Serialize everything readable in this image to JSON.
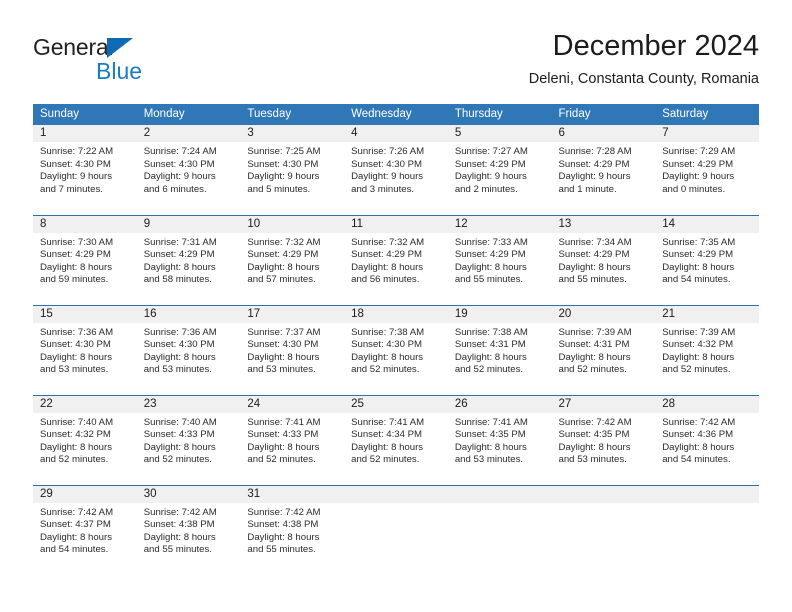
{
  "logo": {
    "word_one": "General",
    "word_two": "Blue",
    "triangle_icon": "blue-triangle-icon",
    "colors": {
      "dark": "#231f20",
      "blue": "#1b7bc4",
      "triangle": "#0d6ab3"
    }
  },
  "header": {
    "title": "December 2024",
    "subtitle": "Deleni, Constanta County, Romania"
  },
  "theme": {
    "header_bg": "#3077b8",
    "header_text": "#ffffff",
    "row_divider": "#2f6fad",
    "daynum_band": "#f0f0f0",
    "body_text": "#2b2b2b",
    "page_bg": "#ffffff"
  },
  "weekday_headers": [
    "Sunday",
    "Monday",
    "Tuesday",
    "Wednesday",
    "Thursday",
    "Friday",
    "Saturday"
  ],
  "weeks": [
    [
      {
        "day": "1",
        "sunrise": "Sunrise: 7:22 AM",
        "sunset": "Sunset: 4:30 PM",
        "daylight_line1": "Daylight: 9 hours",
        "daylight_line2": "and 7 minutes."
      },
      {
        "day": "2",
        "sunrise": "Sunrise: 7:24 AM",
        "sunset": "Sunset: 4:30 PM",
        "daylight_line1": "Daylight: 9 hours",
        "daylight_line2": "and 6 minutes."
      },
      {
        "day": "3",
        "sunrise": "Sunrise: 7:25 AM",
        "sunset": "Sunset: 4:30 PM",
        "daylight_line1": "Daylight: 9 hours",
        "daylight_line2": "and 5 minutes."
      },
      {
        "day": "4",
        "sunrise": "Sunrise: 7:26 AM",
        "sunset": "Sunset: 4:30 PM",
        "daylight_line1": "Daylight: 9 hours",
        "daylight_line2": "and 3 minutes."
      },
      {
        "day": "5",
        "sunrise": "Sunrise: 7:27 AM",
        "sunset": "Sunset: 4:29 PM",
        "daylight_line1": "Daylight: 9 hours",
        "daylight_line2": "and 2 minutes."
      },
      {
        "day": "6",
        "sunrise": "Sunrise: 7:28 AM",
        "sunset": "Sunset: 4:29 PM",
        "daylight_line1": "Daylight: 9 hours",
        "daylight_line2": "and 1 minute."
      },
      {
        "day": "7",
        "sunrise": "Sunrise: 7:29 AM",
        "sunset": "Sunset: 4:29 PM",
        "daylight_line1": "Daylight: 9 hours",
        "daylight_line2": "and 0 minutes."
      }
    ],
    [
      {
        "day": "8",
        "sunrise": "Sunrise: 7:30 AM",
        "sunset": "Sunset: 4:29 PM",
        "daylight_line1": "Daylight: 8 hours",
        "daylight_line2": "and 59 minutes."
      },
      {
        "day": "9",
        "sunrise": "Sunrise: 7:31 AM",
        "sunset": "Sunset: 4:29 PM",
        "daylight_line1": "Daylight: 8 hours",
        "daylight_line2": "and 58 minutes."
      },
      {
        "day": "10",
        "sunrise": "Sunrise: 7:32 AM",
        "sunset": "Sunset: 4:29 PM",
        "daylight_line1": "Daylight: 8 hours",
        "daylight_line2": "and 57 minutes."
      },
      {
        "day": "11",
        "sunrise": "Sunrise: 7:32 AM",
        "sunset": "Sunset: 4:29 PM",
        "daylight_line1": "Daylight: 8 hours",
        "daylight_line2": "and 56 minutes."
      },
      {
        "day": "12",
        "sunrise": "Sunrise: 7:33 AM",
        "sunset": "Sunset: 4:29 PM",
        "daylight_line1": "Daylight: 8 hours",
        "daylight_line2": "and 55 minutes."
      },
      {
        "day": "13",
        "sunrise": "Sunrise: 7:34 AM",
        "sunset": "Sunset: 4:29 PM",
        "daylight_line1": "Daylight: 8 hours",
        "daylight_line2": "and 55 minutes."
      },
      {
        "day": "14",
        "sunrise": "Sunrise: 7:35 AM",
        "sunset": "Sunset: 4:29 PM",
        "daylight_line1": "Daylight: 8 hours",
        "daylight_line2": "and 54 minutes."
      }
    ],
    [
      {
        "day": "15",
        "sunrise": "Sunrise: 7:36 AM",
        "sunset": "Sunset: 4:30 PM",
        "daylight_line1": "Daylight: 8 hours",
        "daylight_line2": "and 53 minutes."
      },
      {
        "day": "16",
        "sunrise": "Sunrise: 7:36 AM",
        "sunset": "Sunset: 4:30 PM",
        "daylight_line1": "Daylight: 8 hours",
        "daylight_line2": "and 53 minutes."
      },
      {
        "day": "17",
        "sunrise": "Sunrise: 7:37 AM",
        "sunset": "Sunset: 4:30 PM",
        "daylight_line1": "Daylight: 8 hours",
        "daylight_line2": "and 53 minutes."
      },
      {
        "day": "18",
        "sunrise": "Sunrise: 7:38 AM",
        "sunset": "Sunset: 4:30 PM",
        "daylight_line1": "Daylight: 8 hours",
        "daylight_line2": "and 52 minutes."
      },
      {
        "day": "19",
        "sunrise": "Sunrise: 7:38 AM",
        "sunset": "Sunset: 4:31 PM",
        "daylight_line1": "Daylight: 8 hours",
        "daylight_line2": "and 52 minutes."
      },
      {
        "day": "20",
        "sunrise": "Sunrise: 7:39 AM",
        "sunset": "Sunset: 4:31 PM",
        "daylight_line1": "Daylight: 8 hours",
        "daylight_line2": "and 52 minutes."
      },
      {
        "day": "21",
        "sunrise": "Sunrise: 7:39 AM",
        "sunset": "Sunset: 4:32 PM",
        "daylight_line1": "Daylight: 8 hours",
        "daylight_line2": "and 52 minutes."
      }
    ],
    [
      {
        "day": "22",
        "sunrise": "Sunrise: 7:40 AM",
        "sunset": "Sunset: 4:32 PM",
        "daylight_line1": "Daylight: 8 hours",
        "daylight_line2": "and 52 minutes."
      },
      {
        "day": "23",
        "sunrise": "Sunrise: 7:40 AM",
        "sunset": "Sunset: 4:33 PM",
        "daylight_line1": "Daylight: 8 hours",
        "daylight_line2": "and 52 minutes."
      },
      {
        "day": "24",
        "sunrise": "Sunrise: 7:41 AM",
        "sunset": "Sunset: 4:33 PM",
        "daylight_line1": "Daylight: 8 hours",
        "daylight_line2": "and 52 minutes."
      },
      {
        "day": "25",
        "sunrise": "Sunrise: 7:41 AM",
        "sunset": "Sunset: 4:34 PM",
        "daylight_line1": "Daylight: 8 hours",
        "daylight_line2": "and 52 minutes."
      },
      {
        "day": "26",
        "sunrise": "Sunrise: 7:41 AM",
        "sunset": "Sunset: 4:35 PM",
        "daylight_line1": "Daylight: 8 hours",
        "daylight_line2": "and 53 minutes."
      },
      {
        "day": "27",
        "sunrise": "Sunrise: 7:42 AM",
        "sunset": "Sunset: 4:35 PM",
        "daylight_line1": "Daylight: 8 hours",
        "daylight_line2": "and 53 minutes."
      },
      {
        "day": "28",
        "sunrise": "Sunrise: 7:42 AM",
        "sunset": "Sunset: 4:36 PM",
        "daylight_line1": "Daylight: 8 hours",
        "daylight_line2": "and 54 minutes."
      }
    ],
    [
      {
        "day": "29",
        "sunrise": "Sunrise: 7:42 AM",
        "sunset": "Sunset: 4:37 PM",
        "daylight_line1": "Daylight: 8 hours",
        "daylight_line2": "and 54 minutes."
      },
      {
        "day": "30",
        "sunrise": "Sunrise: 7:42 AM",
        "sunset": "Sunset: 4:38 PM",
        "daylight_line1": "Daylight: 8 hours",
        "daylight_line2": "and 55 minutes."
      },
      {
        "day": "31",
        "sunrise": "Sunrise: 7:42 AM",
        "sunset": "Sunset: 4:38 PM",
        "daylight_line1": "Daylight: 8 hours",
        "daylight_line2": "and 55 minutes."
      },
      {
        "day": "",
        "sunrise": "",
        "sunset": "",
        "daylight_line1": "",
        "daylight_line2": ""
      },
      {
        "day": "",
        "sunrise": "",
        "sunset": "",
        "daylight_line1": "",
        "daylight_line2": ""
      },
      {
        "day": "",
        "sunrise": "",
        "sunset": "",
        "daylight_line1": "",
        "daylight_line2": ""
      },
      {
        "day": "",
        "sunrise": "",
        "sunset": "",
        "daylight_line1": "",
        "daylight_line2": ""
      }
    ]
  ]
}
